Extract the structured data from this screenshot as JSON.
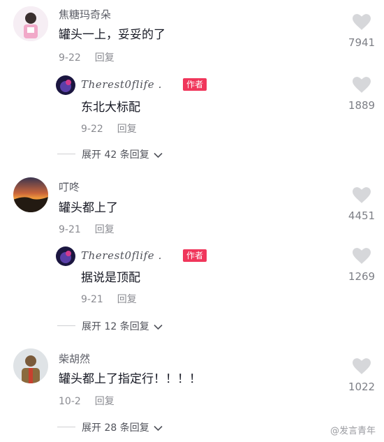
{
  "comments": [
    {
      "username": "焦糖玛奇朵",
      "text": "罐头一上，妥妥的了",
      "date": "9-22",
      "reply_label": "回复",
      "likes": "7941",
      "author_reply": {
        "username": "Therest0flife .",
        "badge": "作者",
        "text": "东北大标配",
        "date": "9-22",
        "reply_label": "回复",
        "likes": "1889"
      },
      "expand": "展开 42 条回复"
    },
    {
      "username": "叮咚",
      "text": "罐头都上了",
      "date": "9-21",
      "reply_label": "回复",
      "likes": "4451",
      "author_reply": {
        "username": "Therest0flife .",
        "badge": "作者",
        "text": "据说是顶配",
        "date": "9-21",
        "reply_label": "回复",
        "likes": "1269"
      },
      "expand": "展开 12 条回复"
    },
    {
      "username": "柴胡然",
      "text": "罐头都上了指定行！！！！",
      "date": "10-2",
      "reply_label": "回复",
      "likes": "1022",
      "expand": "展开 28 条回复"
    }
  ],
  "watermark": "@发言青年",
  "colors": {
    "badge": "#f0365b",
    "text": "#161823",
    "muted": "#8a8b91",
    "heart": "#d6d7da"
  }
}
